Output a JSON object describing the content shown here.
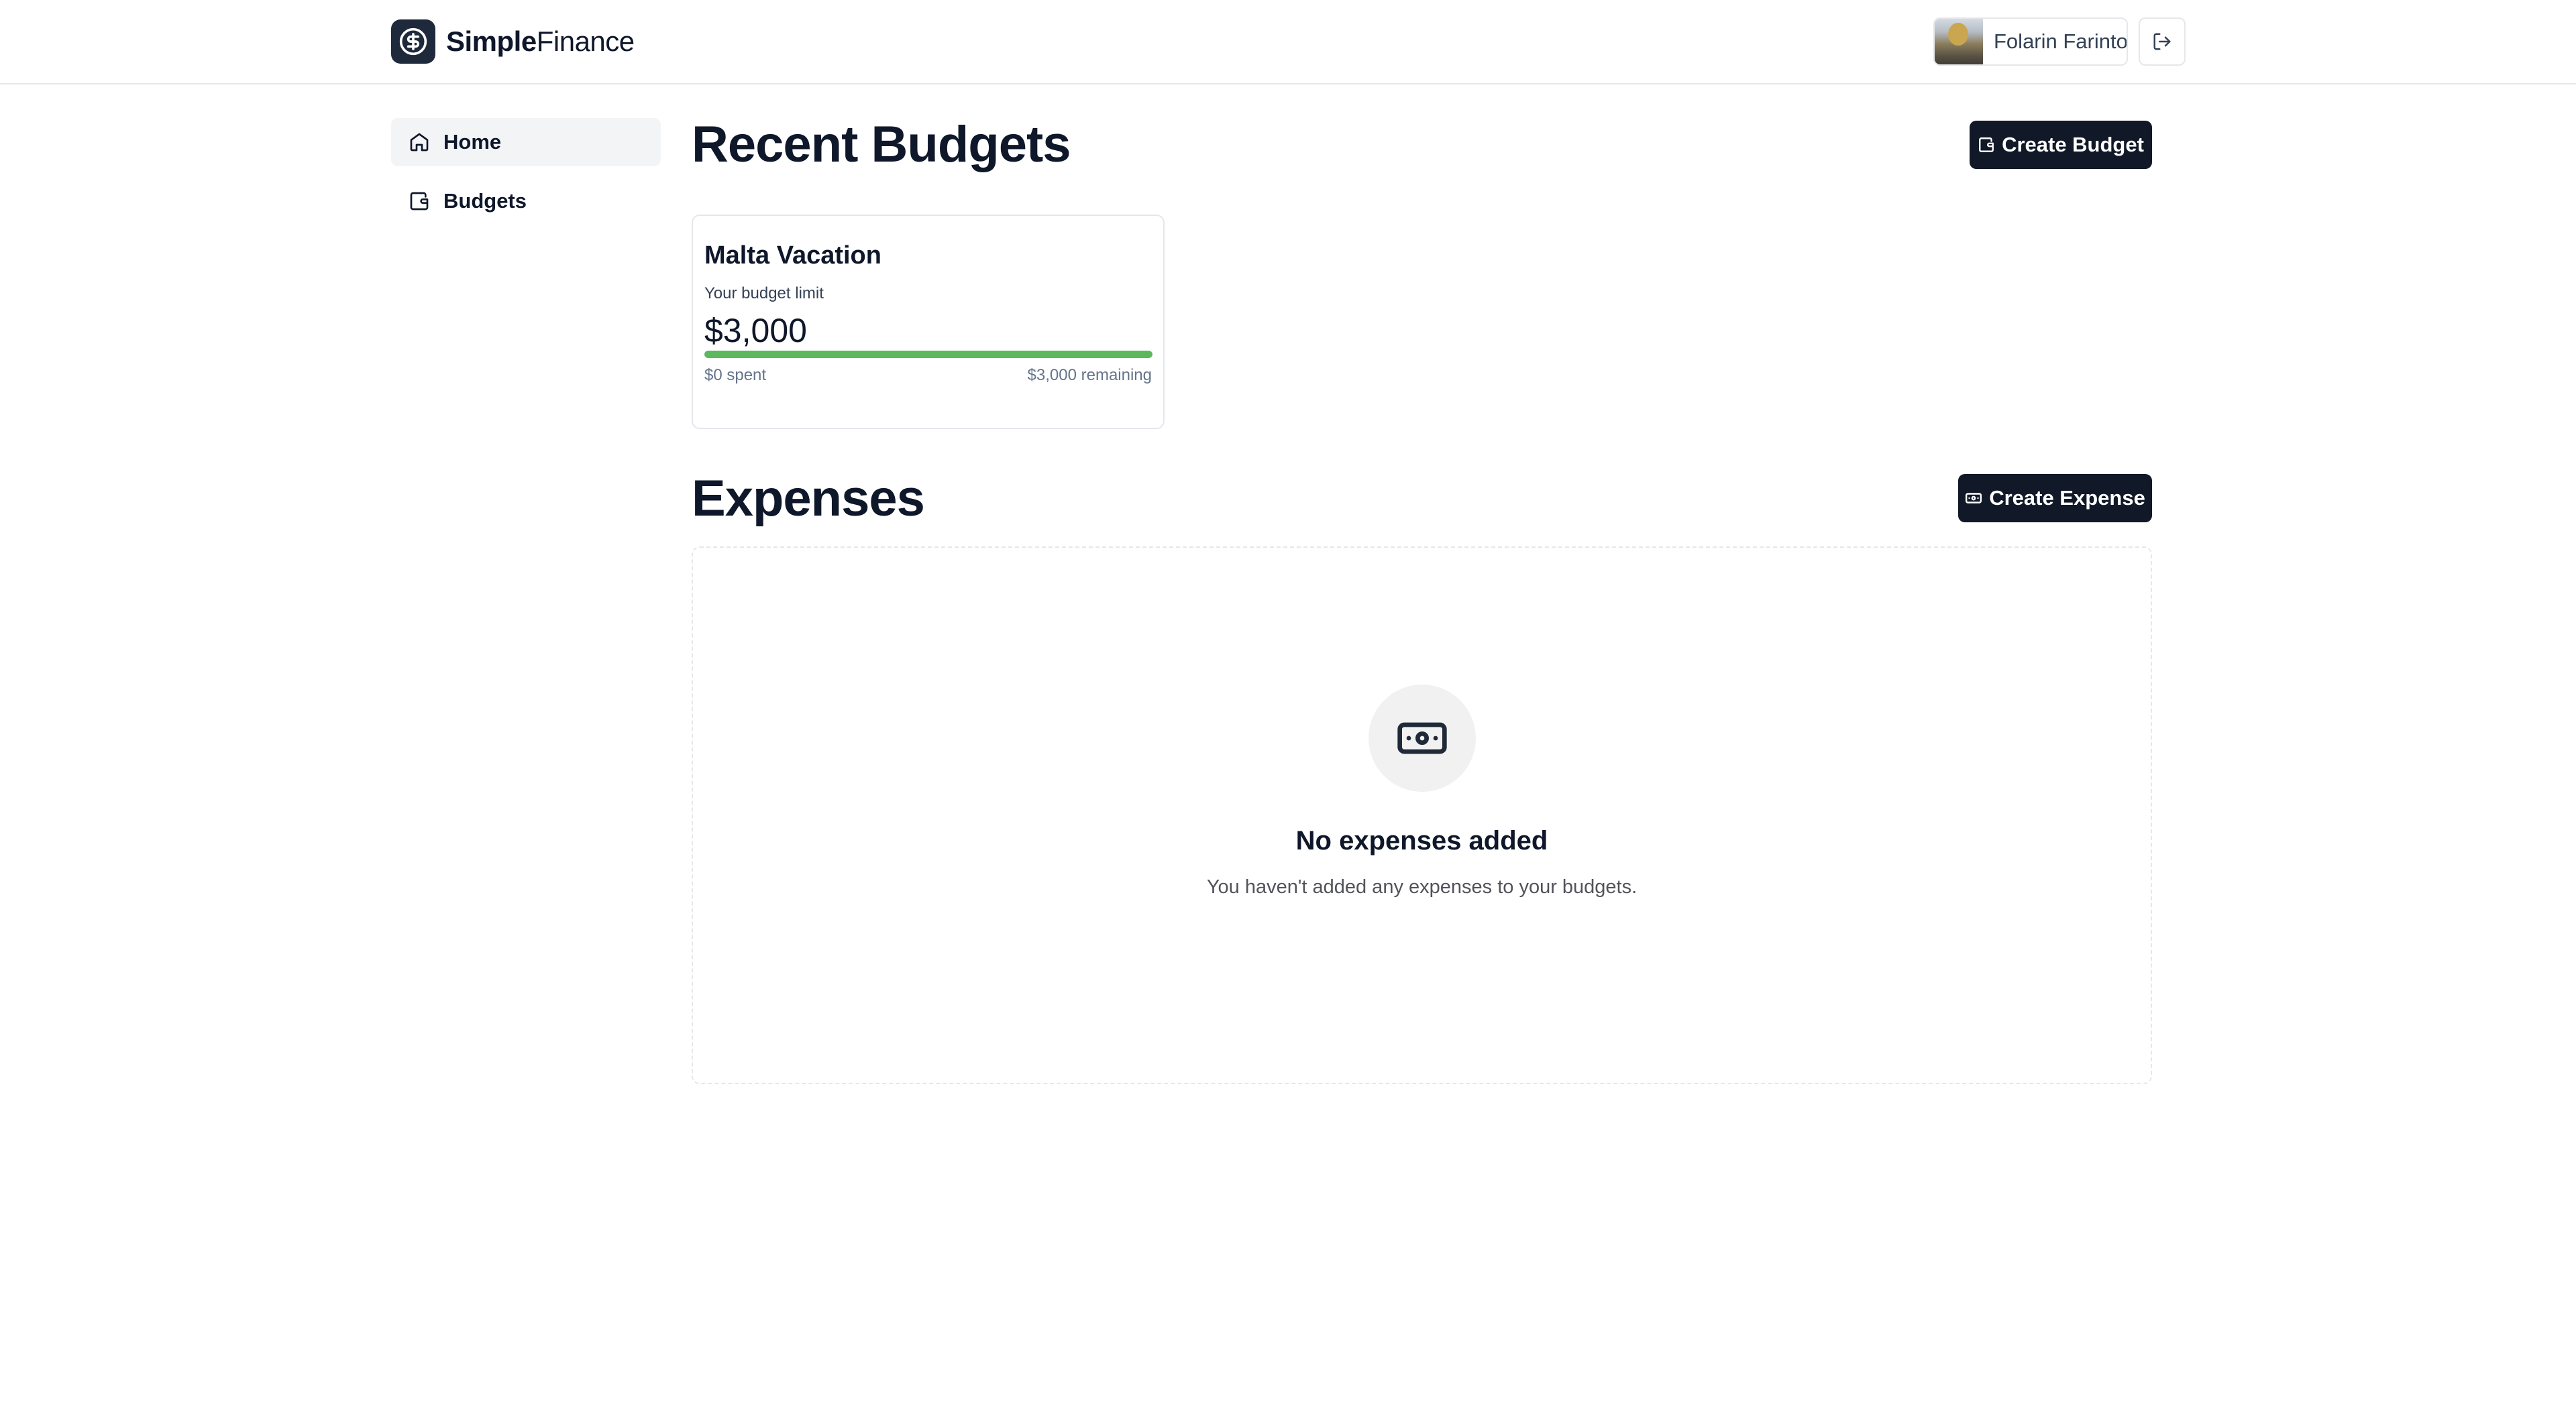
{
  "brand": {
    "name_strong": "Simple",
    "name_light": "Finance",
    "logo_icon": "dollar-circle-icon"
  },
  "user": {
    "name": "Folarin Farinto"
  },
  "sidebar": {
    "items": [
      {
        "label": "Home",
        "icon": "home-icon",
        "active": true
      },
      {
        "label": "Budgets",
        "icon": "wallet-icon",
        "active": false
      }
    ]
  },
  "budgets": {
    "title": "Recent Budgets",
    "create_label": "Create Budget",
    "cards": [
      {
        "name": "Malta Vacation",
        "limit_label": "Your budget limit",
        "amount": "$3,000",
        "spent": "$0 spent",
        "remaining": "$3,000 remaining",
        "remaining_fraction": 1.0,
        "bar_color": "#5cb85c"
      }
    ]
  },
  "expenses": {
    "title": "Expenses",
    "create_label": "Create Expense",
    "empty_title": "No expenses added",
    "empty_subtitle": "You haven't added any expenses to your budgets."
  },
  "colors": {
    "primary": "#111827",
    "progress": "#5cb85c",
    "border": "#e5e7eb"
  }
}
